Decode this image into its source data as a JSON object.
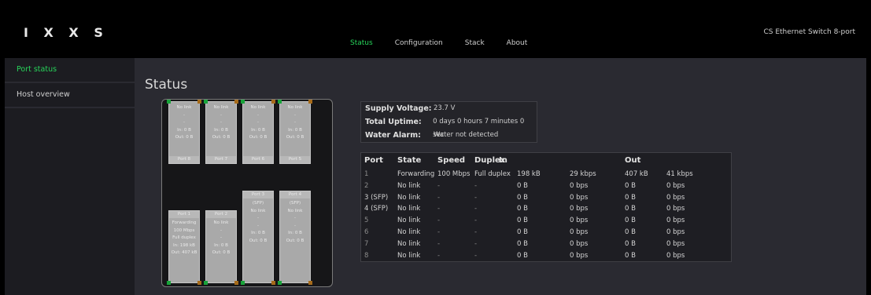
{
  "header": {
    "logo": "IXXS",
    "logo_display": "I X X S",
    "nav": [
      {
        "label": "Status",
        "active": true
      },
      {
        "label": "Configuration",
        "active": false
      },
      {
        "label": "Stack",
        "active": false
      },
      {
        "label": "About",
        "active": false
      }
    ],
    "product_name": "CS Ethernet Switch 8-port"
  },
  "sidebar": {
    "items": [
      {
        "label": "Port status",
        "active": true
      },
      {
        "label": "Host overview",
        "active": false
      }
    ]
  },
  "main": {
    "title": "Status",
    "switch_ports": {
      "top": [
        {
          "name": "Port 8",
          "lines": [
            "No link",
            "-",
            "-",
            "In: 0 B",
            "Out: 0 B"
          ]
        },
        {
          "name": "Port 7",
          "lines": [
            "No link",
            "-",
            "-",
            "In: 0 B",
            "Out: 0 B"
          ]
        },
        {
          "name": "Port 6",
          "lines": [
            "No link",
            "-",
            "-",
            "In: 0 B",
            "Out: 0 B"
          ]
        },
        {
          "name": "Port 5",
          "lines": [
            "No link",
            "-",
            "-",
            "In: 0 B",
            "Out: 0 B"
          ]
        }
      ],
      "bottom": [
        {
          "name": "Port 1",
          "lines": [
            "Forwarding",
            "100 Mbps",
            "Full duplex",
            "In: 198 kB",
            "Out: 407 kB"
          ]
        },
        {
          "name": "Port 2",
          "lines": [
            "No link",
            "-",
            "-",
            "In: 0 B",
            "Out: 0 B"
          ]
        },
        {
          "name": "Port 3",
          "sub": "(SFP)",
          "lines": [
            "No link",
            "-",
            "-",
            "In: 0 B",
            "Out: 0 B"
          ]
        },
        {
          "name": "Port 4",
          "sub": "(SFP)",
          "lines": [
            "No link",
            "-",
            "-",
            "In: 0 B",
            "Out: 0 B"
          ]
        }
      ]
    },
    "info": {
      "supply_voltage_label": "Supply Voltage:",
      "supply_voltage": "23.7 V",
      "uptime_label": "Total Uptime:",
      "uptime": "0 days 0 hours 7 minutes 0 sec",
      "water_alarm_label": "Water Alarm:",
      "water_alarm": "Water not detected"
    },
    "port_table": {
      "headers": [
        "Port",
        "State",
        "Speed",
        "Duplex",
        "In",
        "Out"
      ],
      "rows": [
        [
          "1",
          "Forwarding",
          "100 Mbps",
          "Full duplex",
          "198 kB",
          "29 kbps",
          "407 kB",
          "41 kbps"
        ],
        [
          "2",
          "No link",
          "-",
          "-",
          "0 B",
          "0 bps",
          "0 B",
          "0 bps"
        ],
        [
          "3 (SFP)",
          "No link",
          "-",
          "-",
          "0 B",
          "0 bps",
          "0 B",
          "0 bps"
        ],
        [
          "4 (SFP)",
          "No link",
          "-",
          "-",
          "0 B",
          "0 bps",
          "0 B",
          "0 bps"
        ],
        [
          "5",
          "No link",
          "-",
          "-",
          "0 B",
          "0 bps",
          "0 B",
          "0 bps"
        ],
        [
          "6",
          "No link",
          "-",
          "-",
          "0 B",
          "0 bps",
          "0 B",
          "0 bps"
        ],
        [
          "7",
          "No link",
          "-",
          "-",
          "0 B",
          "0 bps",
          "0 B",
          "0 bps"
        ],
        [
          "8",
          "No link",
          "-",
          "-",
          "0 B",
          "0 bps",
          "0 B",
          "0 bps"
        ]
      ]
    }
  },
  "colors": {
    "accent": "#27d45a",
    "background": "#2a2a31",
    "header": "#000000",
    "led_green": "#19a33a",
    "led_orange": "#a56a1a"
  }
}
